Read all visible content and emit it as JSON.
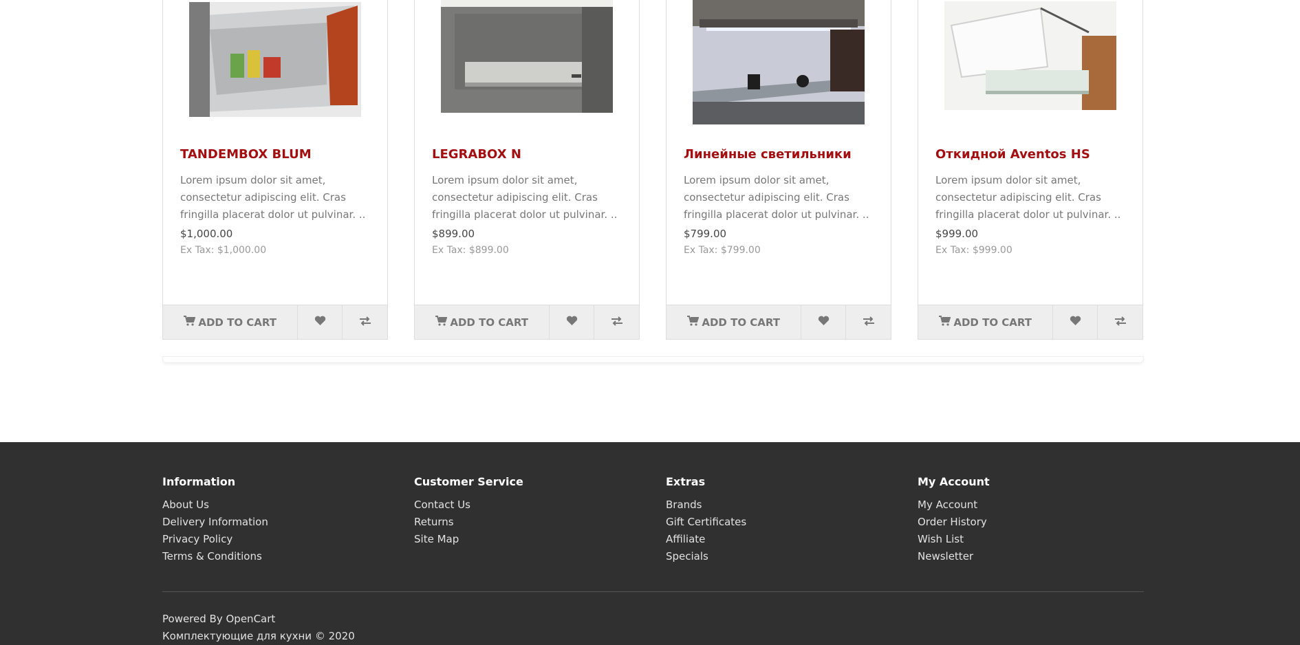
{
  "products": [
    {
      "name": "TANDEMBOX BLUM",
      "description": "Lorem ipsum dolor sit amet, consectetur adipiscing elit. Cras fringilla placerat dolor ut pulvinar. ..",
      "price": "$1,000.00",
      "ex_tax": "Ex Tax: $1,000.00"
    },
    {
      "name": "LEGRABOX N",
      "description": "Lorem ipsum dolor sit amet, consectetur adipiscing elit. Cras fringilla placerat dolor ut pulvinar. ..",
      "price": "$899.00",
      "ex_tax": "Ex Tax: $899.00"
    },
    {
      "name": "Линейные светильники",
      "description": "Lorem ipsum dolor sit amet, consectetur adipiscing elit. Cras fringilla placerat dolor ut pulvinar. ..",
      "price": "$799.00",
      "ex_tax": "Ex Tax: $799.00"
    },
    {
      "name": "Откидной Aventos HS",
      "description": "Lorem ipsum dolor sit amet, consectetur adipiscing elit. Cras fringilla placerat dolor ut pulvinar. ..",
      "price": "$999.00",
      "ex_tax": "Ex Tax: $999.00"
    }
  ],
  "buttons": {
    "add_to_cart": "Add to Cart",
    "cart_icon": "shopping-cart-icon",
    "wishlist_icon": "heart-icon",
    "compare_icon": "exchange-arrows-icon"
  },
  "footer": {
    "columns": [
      {
        "title": "Information",
        "links": [
          "About Us",
          "Delivery Information",
          "Privacy Policy",
          "Terms & Conditions"
        ]
      },
      {
        "title": "Customer Service",
        "links": [
          "Contact Us",
          "Returns",
          "Site Map"
        ]
      },
      {
        "title": "Extras",
        "links": [
          "Brands",
          "Gift Certificates",
          "Affiliate",
          "Specials"
        ]
      },
      {
        "title": "My Account",
        "links": [
          "My Account",
          "Order History",
          "Wish List",
          "Newsletter"
        ]
      }
    ],
    "powered_by": "Powered By",
    "powered_link": "OpenCart",
    "copyright": "Комплектующие для кухни © 2020"
  },
  "colors": {
    "accent": "#a30e10",
    "footer_bg": "#303030",
    "button_bg": "#eeeeee"
  }
}
